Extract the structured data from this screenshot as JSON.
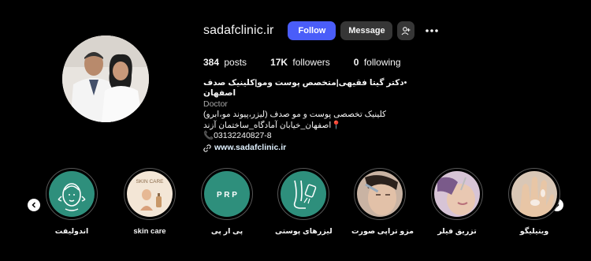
{
  "profile": {
    "username": "sadafclinic.ir",
    "follow_label": "Follow",
    "message_label": "Message",
    "stats": {
      "posts_count": "384",
      "posts_label": "posts",
      "followers_count": "17K",
      "followers_label": "followers",
      "following_count": "0",
      "following_label": "following"
    },
    "bio": {
      "name": "•دکتر گیتا فقیهی|متخصص پوست ومو|کلینیک صدف اصفهان",
      "category": "Doctor",
      "line1": "کلینیک تخصصی پوست و مو صدف (لیزر،پیوند مو،ابرو)",
      "line2": "📍اصفهان_خیابان آمادگاه_ساختمان آزند",
      "line3": "📞03132240827-8",
      "link": "www.sadafclinic.ir"
    }
  },
  "highlights": [
    {
      "label": "اندولیفت",
      "icon": "face-lift-icon"
    },
    {
      "label": "skin care",
      "icon": "skin-care-icon",
      "image_text": "SKIN CARE"
    },
    {
      "label": "پی ار پی",
      "icon": "prp-icon",
      "image_text": "P R P"
    },
    {
      "label": "لیزرهای پوستی",
      "icon": "laser-leg-icon"
    },
    {
      "label": "مزو تراپی صورت",
      "icon": "mesotherapy-photo"
    },
    {
      "label": "تزریق فیلر",
      "icon": "filler-photo"
    },
    {
      "label": "ویتیلیگو",
      "icon": "vitiligo-photo"
    }
  ],
  "colors": {
    "background": "#000000",
    "follow_button": "#4a5df9",
    "secondary_button": "#363636",
    "teal_highlight": "#2e8f7c"
  }
}
